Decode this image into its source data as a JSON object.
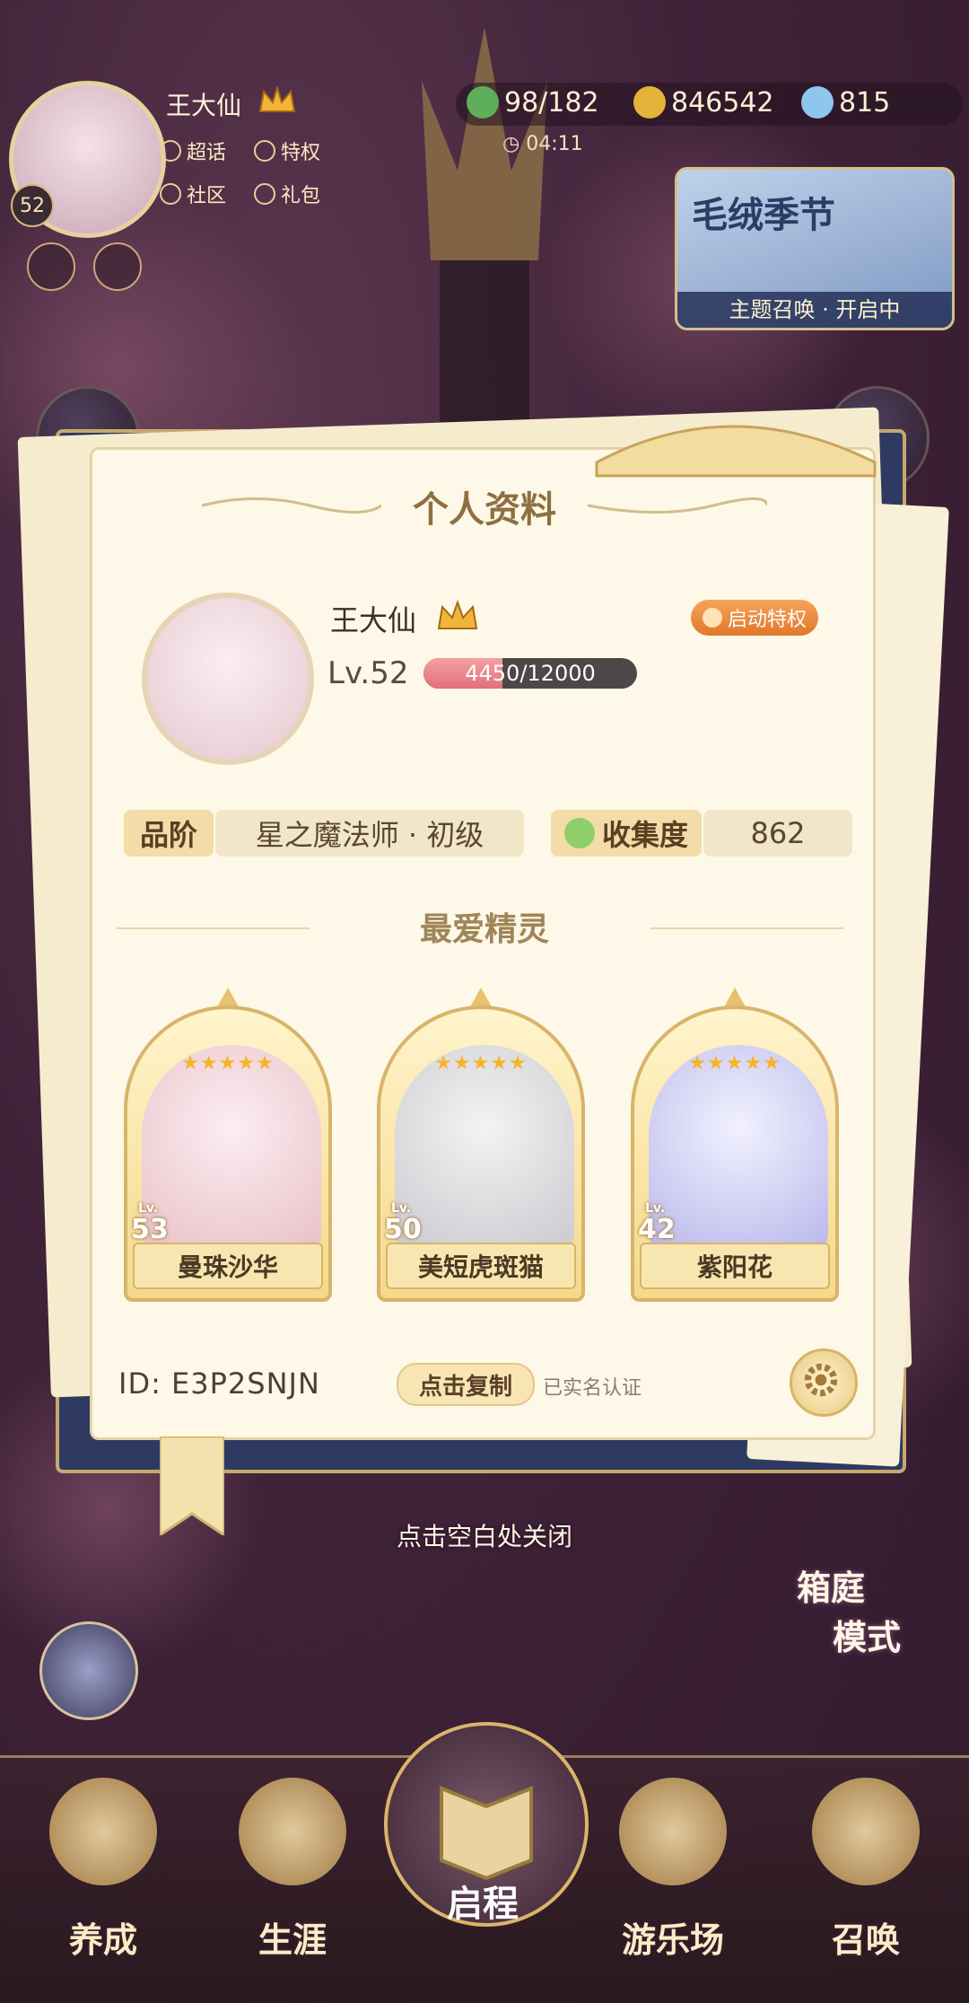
{
  "hud": {
    "player_name": "王大仙",
    "player_level": "52",
    "links": [
      "超话",
      "特权",
      "社区",
      "礼包"
    ],
    "stamina": "98/182",
    "gold": "846542",
    "gems": "815",
    "timer": "04:11"
  },
  "banner": {
    "title": "毛绒季节",
    "footer": "主题召唤 · 开启中"
  },
  "panel": {
    "title": "个人资料",
    "name": "王大仙",
    "privilege_button": "启动特权",
    "level_label": "Lv.52",
    "exp_current": 4450,
    "exp_max": 12000,
    "exp_text": "4450/12000",
    "rank_label": "品阶",
    "rank_value": "星之魔法师 · 初级",
    "collection_label": "收集度",
    "collection_value": "862",
    "favorites_title": "最爱精灵",
    "favorites": [
      {
        "name": "曼珠沙华",
        "level": "53",
        "lv_prefix": "Lv.",
        "stars": "★★★★★"
      },
      {
        "name": "美短虎斑猫",
        "level": "50",
        "lv_prefix": "Lv.",
        "stars": "★★★★★"
      },
      {
        "name": "紫阳花",
        "level": "42",
        "lv_prefix": "Lv.",
        "stars": "★★★★★"
      }
    ],
    "id_text": "ID:  E3P2SNJN",
    "copy_button": "点击复制",
    "verified_text": "已实名认证"
  },
  "close_hint": "点击空白处关闭",
  "garden_mode": "箱庭\n模式",
  "garden_line1": "箱庭",
  "garden_line2": "模式",
  "nav": {
    "items": [
      "养成",
      "生涯",
      "启程",
      "游乐场",
      "召唤"
    ]
  },
  "colors": {
    "accent_gold": "#d8b46a",
    "exp_fill": "#e0707a",
    "privilege_orange": "#e0782a"
  }
}
